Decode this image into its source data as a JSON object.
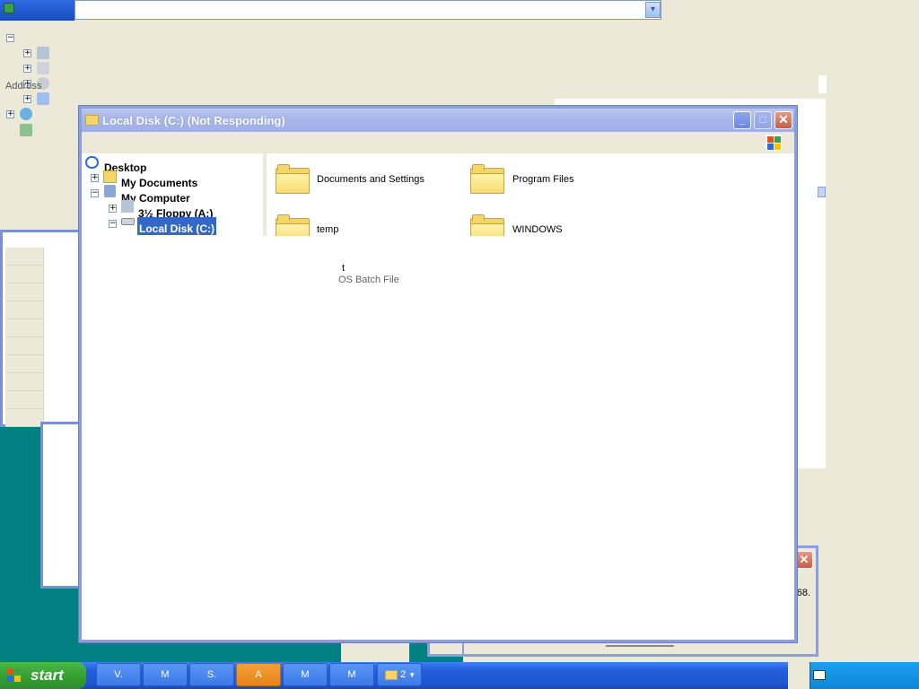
{
  "address_bar": {
    "label": "Address",
    "dropdown_icon": "chevron-down-icon"
  },
  "window": {
    "title": "Local Disk (C:) (Not Responding)",
    "buttons": {
      "minimize": "_",
      "maximize": "□",
      "close": "✕"
    }
  },
  "tree": {
    "desktop": "Desktop",
    "my_documents": "My Documents",
    "my_computer": "My Computer",
    "floppy": "3½ Floppy (A:)",
    "local_disk": "Local Disk (C:)"
  },
  "files": [
    {
      "name": "Documents and Settings",
      "icon": "folder-icon"
    },
    {
      "name": "Program Files",
      "icon": "folder-icon"
    },
    {
      "name": "temp",
      "icon": "folder-icon"
    },
    {
      "name": "WINDOWS",
      "icon": "folder-icon"
    }
  ],
  "ghost_file": {
    "name": "t",
    "type": "OS Batch File"
  },
  "background_dialog": {
    "text": "68.",
    "close": "✕"
  },
  "taskbar": {
    "start_label": "start",
    "tasks": [
      {
        "label": "V.",
        "active": false
      },
      {
        "label": "M",
        "active": false
      },
      {
        "label": "S.",
        "active": false
      },
      {
        "label": "A",
        "active": true
      },
      {
        "label": "M",
        "active": false
      },
      {
        "label": "M",
        "active": false
      }
    ],
    "group": {
      "count": "2",
      "icon": "folder-icon"
    }
  },
  "colors": {
    "taskbar": "#245edb",
    "start": "#35a233",
    "active_task": "#e6841a",
    "desktop": "#008080"
  }
}
